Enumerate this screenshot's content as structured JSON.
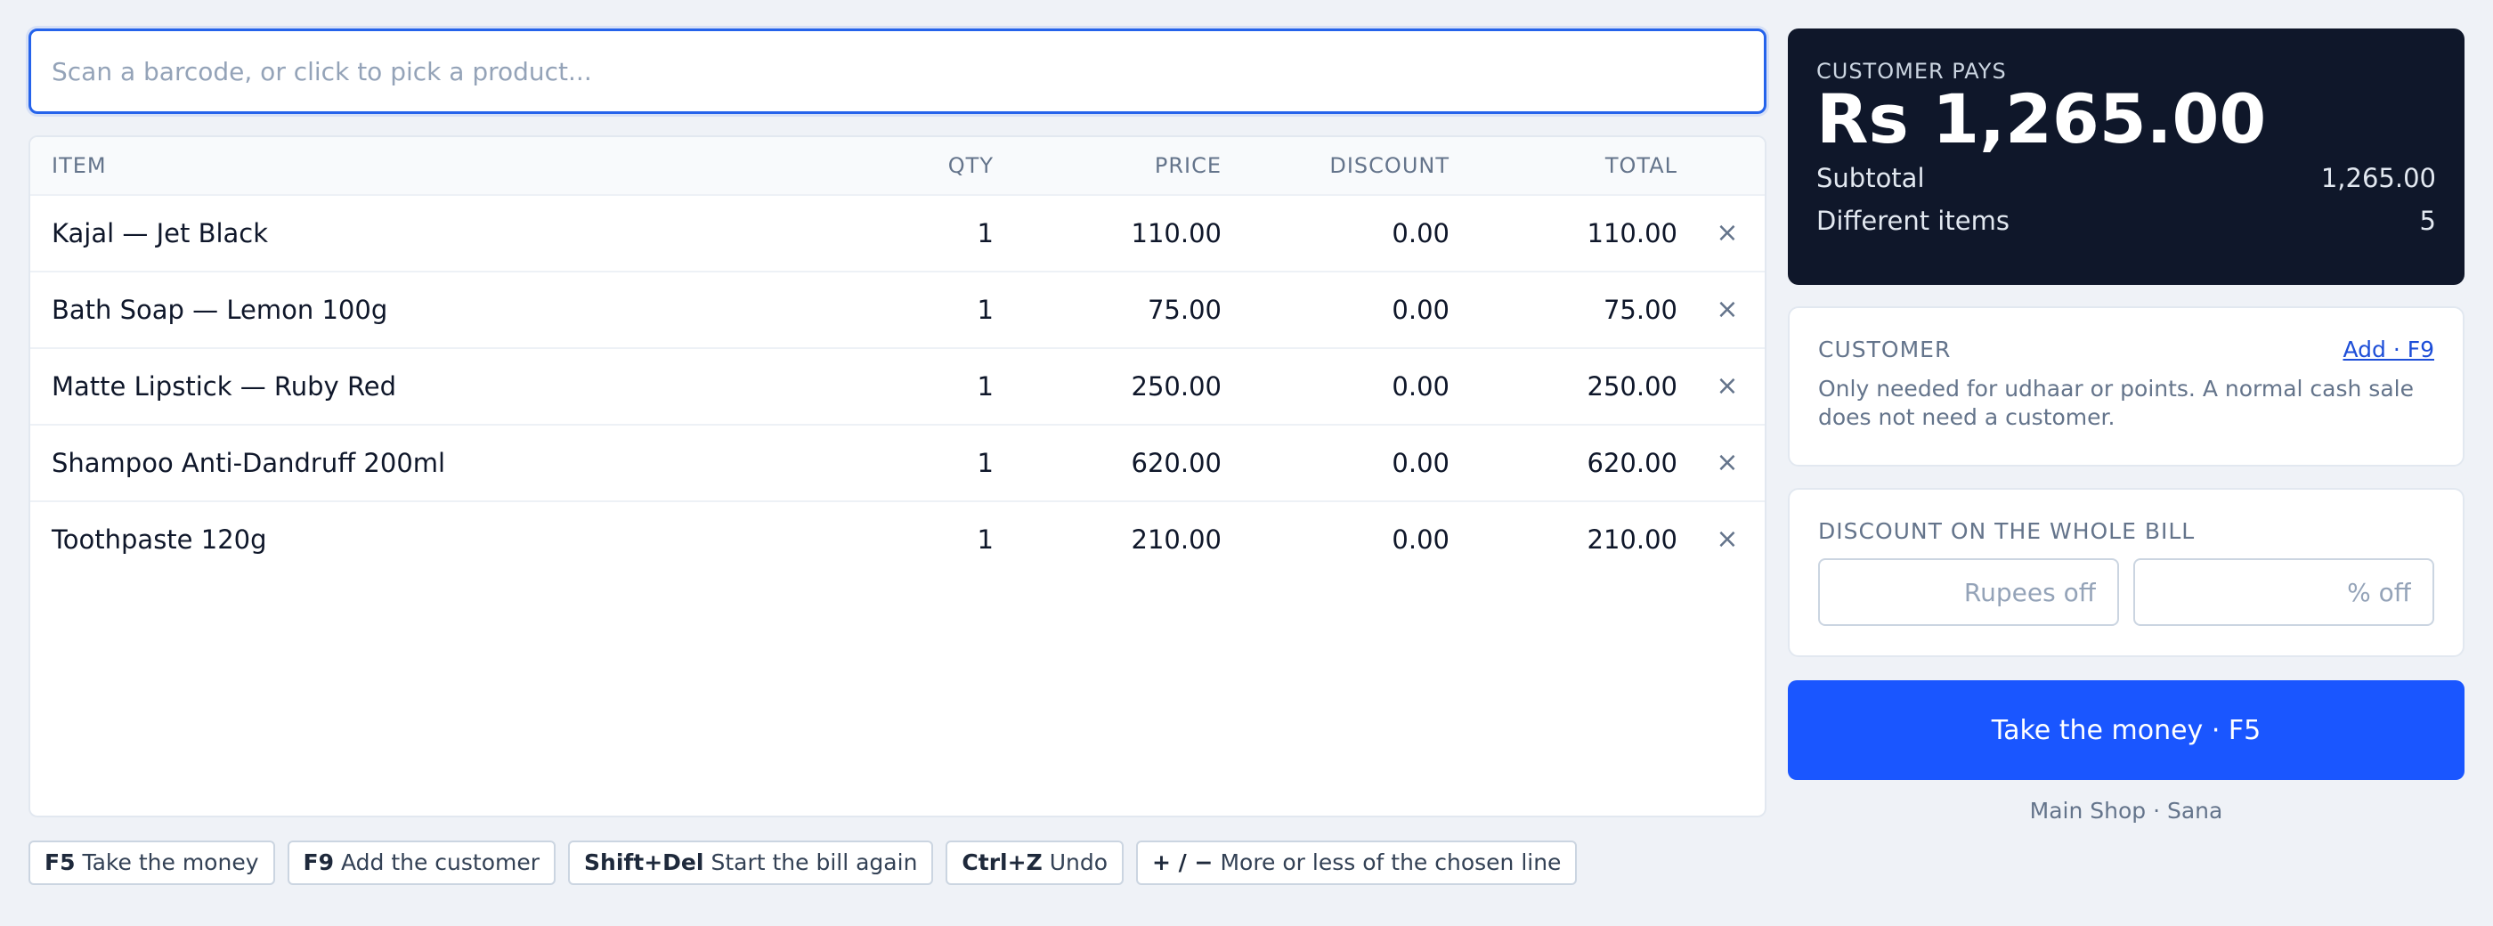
{
  "search": {
    "placeholder": "Scan a barcode, or click to pick a product..."
  },
  "table": {
    "columns": {
      "item": "ITEM",
      "qty": "QTY",
      "price": "PRICE",
      "discount": "DISCOUNT",
      "total": "TOTAL"
    },
    "remove_symbol": "×",
    "rows": [
      {
        "item": "Kajal — Jet Black",
        "qty": "1",
        "price": "110.00",
        "discount": "0.00",
        "total": "110.00"
      },
      {
        "item": "Bath Soap — Lemon 100g",
        "qty": "1",
        "price": "75.00",
        "discount": "0.00",
        "total": "75.00"
      },
      {
        "item": "Matte Lipstick — Ruby Red",
        "qty": "1",
        "price": "250.00",
        "discount": "0.00",
        "total": "250.00"
      },
      {
        "item": "Shampoo Anti-Dandruff 200ml",
        "qty": "1",
        "price": "620.00",
        "discount": "0.00",
        "total": "620.00"
      },
      {
        "item": "Toothpaste 120g",
        "qty": "1",
        "price": "210.00",
        "discount": "0.00",
        "total": "210.00"
      }
    ]
  },
  "summary": {
    "label": "CUSTOMER PAYS",
    "amount": "Rs 1,265.00",
    "subtotal_label": "Subtotal",
    "subtotal_value": "1,265.00",
    "items_label": "Different items",
    "items_value": "5"
  },
  "customer": {
    "label": "CUSTOMER",
    "add_link": "Add · F9",
    "note": "Only needed for udhaar or points. A normal cash sale does not need a customer."
  },
  "discount": {
    "label": "DISCOUNT ON THE WHOLE BILL",
    "rupees_placeholder": "Rupees off",
    "percent_placeholder": "% off"
  },
  "pay_button": "Take the money · F5",
  "shop_line": "Main Shop · Sana",
  "shortcuts": [
    {
      "key": "F5",
      "label": "Take the money"
    },
    {
      "key": "F9",
      "label": "Add the customer"
    },
    {
      "key": "Shift+Del",
      "label": "Start the bill again"
    },
    {
      "key": "Ctrl+Z",
      "label": "Undo"
    },
    {
      "key": "+ / −",
      "label": "More or less of the chosen line"
    }
  ],
  "colors": {
    "accent": "#2563eb",
    "pay_button": "#1a56ff",
    "summary_bg": "#0f172a",
    "page_bg": "#eff2f7"
  },
  "icons": {
    "remove": "close-icon"
  }
}
